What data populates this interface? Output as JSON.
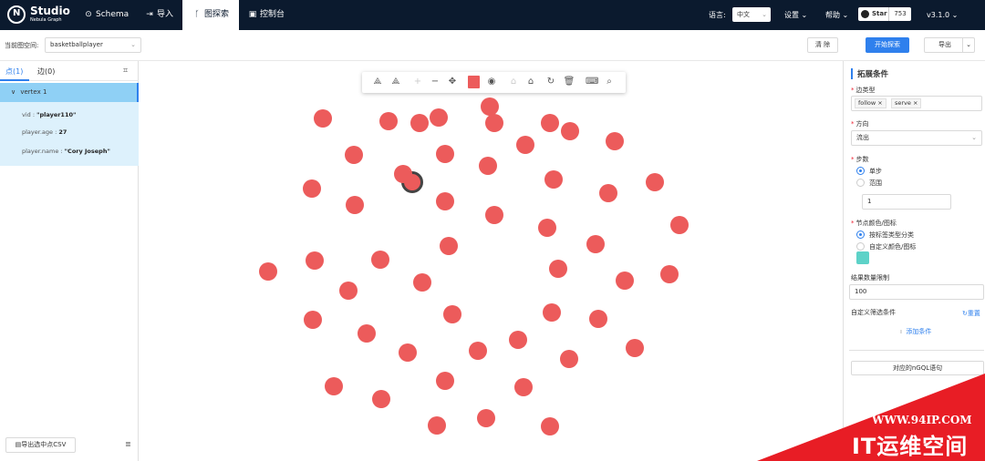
{
  "topbar": {
    "logo_name": "Studio",
    "logo_sub": "Nebula Graph",
    "nav": [
      {
        "label": "Schema",
        "icon": "schema-icon"
      },
      {
        "label": "导入",
        "icon": "import-icon"
      },
      {
        "label": "图探索",
        "icon": "explore-icon"
      },
      {
        "label": "控制台",
        "icon": "console-icon"
      }
    ],
    "lang_label": "语言:",
    "lang_value": "中文",
    "settings": "设置",
    "help": "帮助",
    "star_label": "Star",
    "star_count": "753",
    "version": "v3.1.0"
  },
  "subbar": {
    "space_label": "当前图空间:",
    "space_value": "basketballplayer",
    "clear": "清 除",
    "start": "开始探索",
    "export": "导出"
  },
  "leftpanel": {
    "tab_vertex": "点(1)",
    "tab_edge": "边(0)",
    "vertex_title": "vertex 1",
    "props": [
      {
        "key": "vid :",
        "value": "\"player110\""
      },
      {
        "key": "player.age :",
        "value": "27"
      },
      {
        "key": "player.name :",
        "value": "\"Cory Joseph\""
      }
    ],
    "export_csv": "导出选中点CSV"
  },
  "toolbar_icons": [
    "expand-icon",
    "common-neighbor-icon",
    "zoom-in-icon",
    "zoom-out-icon",
    "move-icon",
    "color-swatch-icon",
    "hide-icon",
    "lock-icon",
    "unlock-icon",
    "undo-icon",
    "delete-icon",
    "keyboard-icon",
    "search-icon"
  ],
  "rightpanel": {
    "title": "拓展条件",
    "edge_type_label": "边类型",
    "edge_tags": [
      "follow",
      "serve"
    ],
    "direction_label": "方向",
    "direction_value": "流出",
    "steps_label": "步数",
    "step_single": "单步",
    "step_range": "范围",
    "step_value": "1",
    "color_label": "节点颜色/图标",
    "color_by_tag": "按标签类型分类",
    "color_custom": "自定义颜色/图标",
    "node_color": "#5dd2c8",
    "limit_label": "结果数量限制",
    "limit_value": "100",
    "filter_label": "自定义筛选条件",
    "reset": "重置",
    "add_condition": "添加条件",
    "ngql": "对应的nGQL语句"
  },
  "colors": {
    "node": "#ec5b5b",
    "primary": "#2f80ed",
    "topbar": "#0b1a2e"
  },
  "watermark": {
    "url": "WWW.94IP.COM",
    "text": "IT运维空间"
  }
}
